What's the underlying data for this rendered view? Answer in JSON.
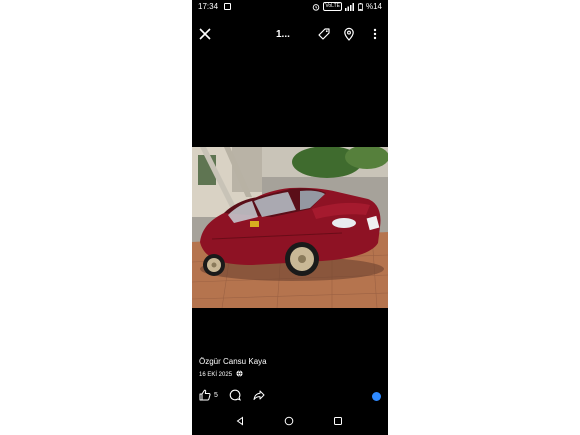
{
  "status_bar": {
    "time": "17:34",
    "volte": "VoLTE",
    "battery": "%14",
    "icons": [
      "app-notification-icon",
      "alarm-icon",
      "signal-icon",
      "battery-icon"
    ]
  },
  "top_bar": {
    "counter": "1...",
    "icons": [
      "close-icon",
      "tag-icon",
      "location-pin-icon",
      "more-vertical-icon"
    ]
  },
  "post": {
    "author": "Özgür Cansu Kaya",
    "date": "16 EKİ 2025",
    "privacy_icon": "globe-icon",
    "like_count": "5"
  },
  "actions": [
    "like-icon",
    "comment-icon",
    "share-icon"
  ],
  "nav_bar": [
    "back-icon",
    "home-icon",
    "recents-icon"
  ],
  "colors": {
    "background": "#000000",
    "text": "#ffffff",
    "reaction_badge": "#2e89ff",
    "car": "#8e1224"
  }
}
